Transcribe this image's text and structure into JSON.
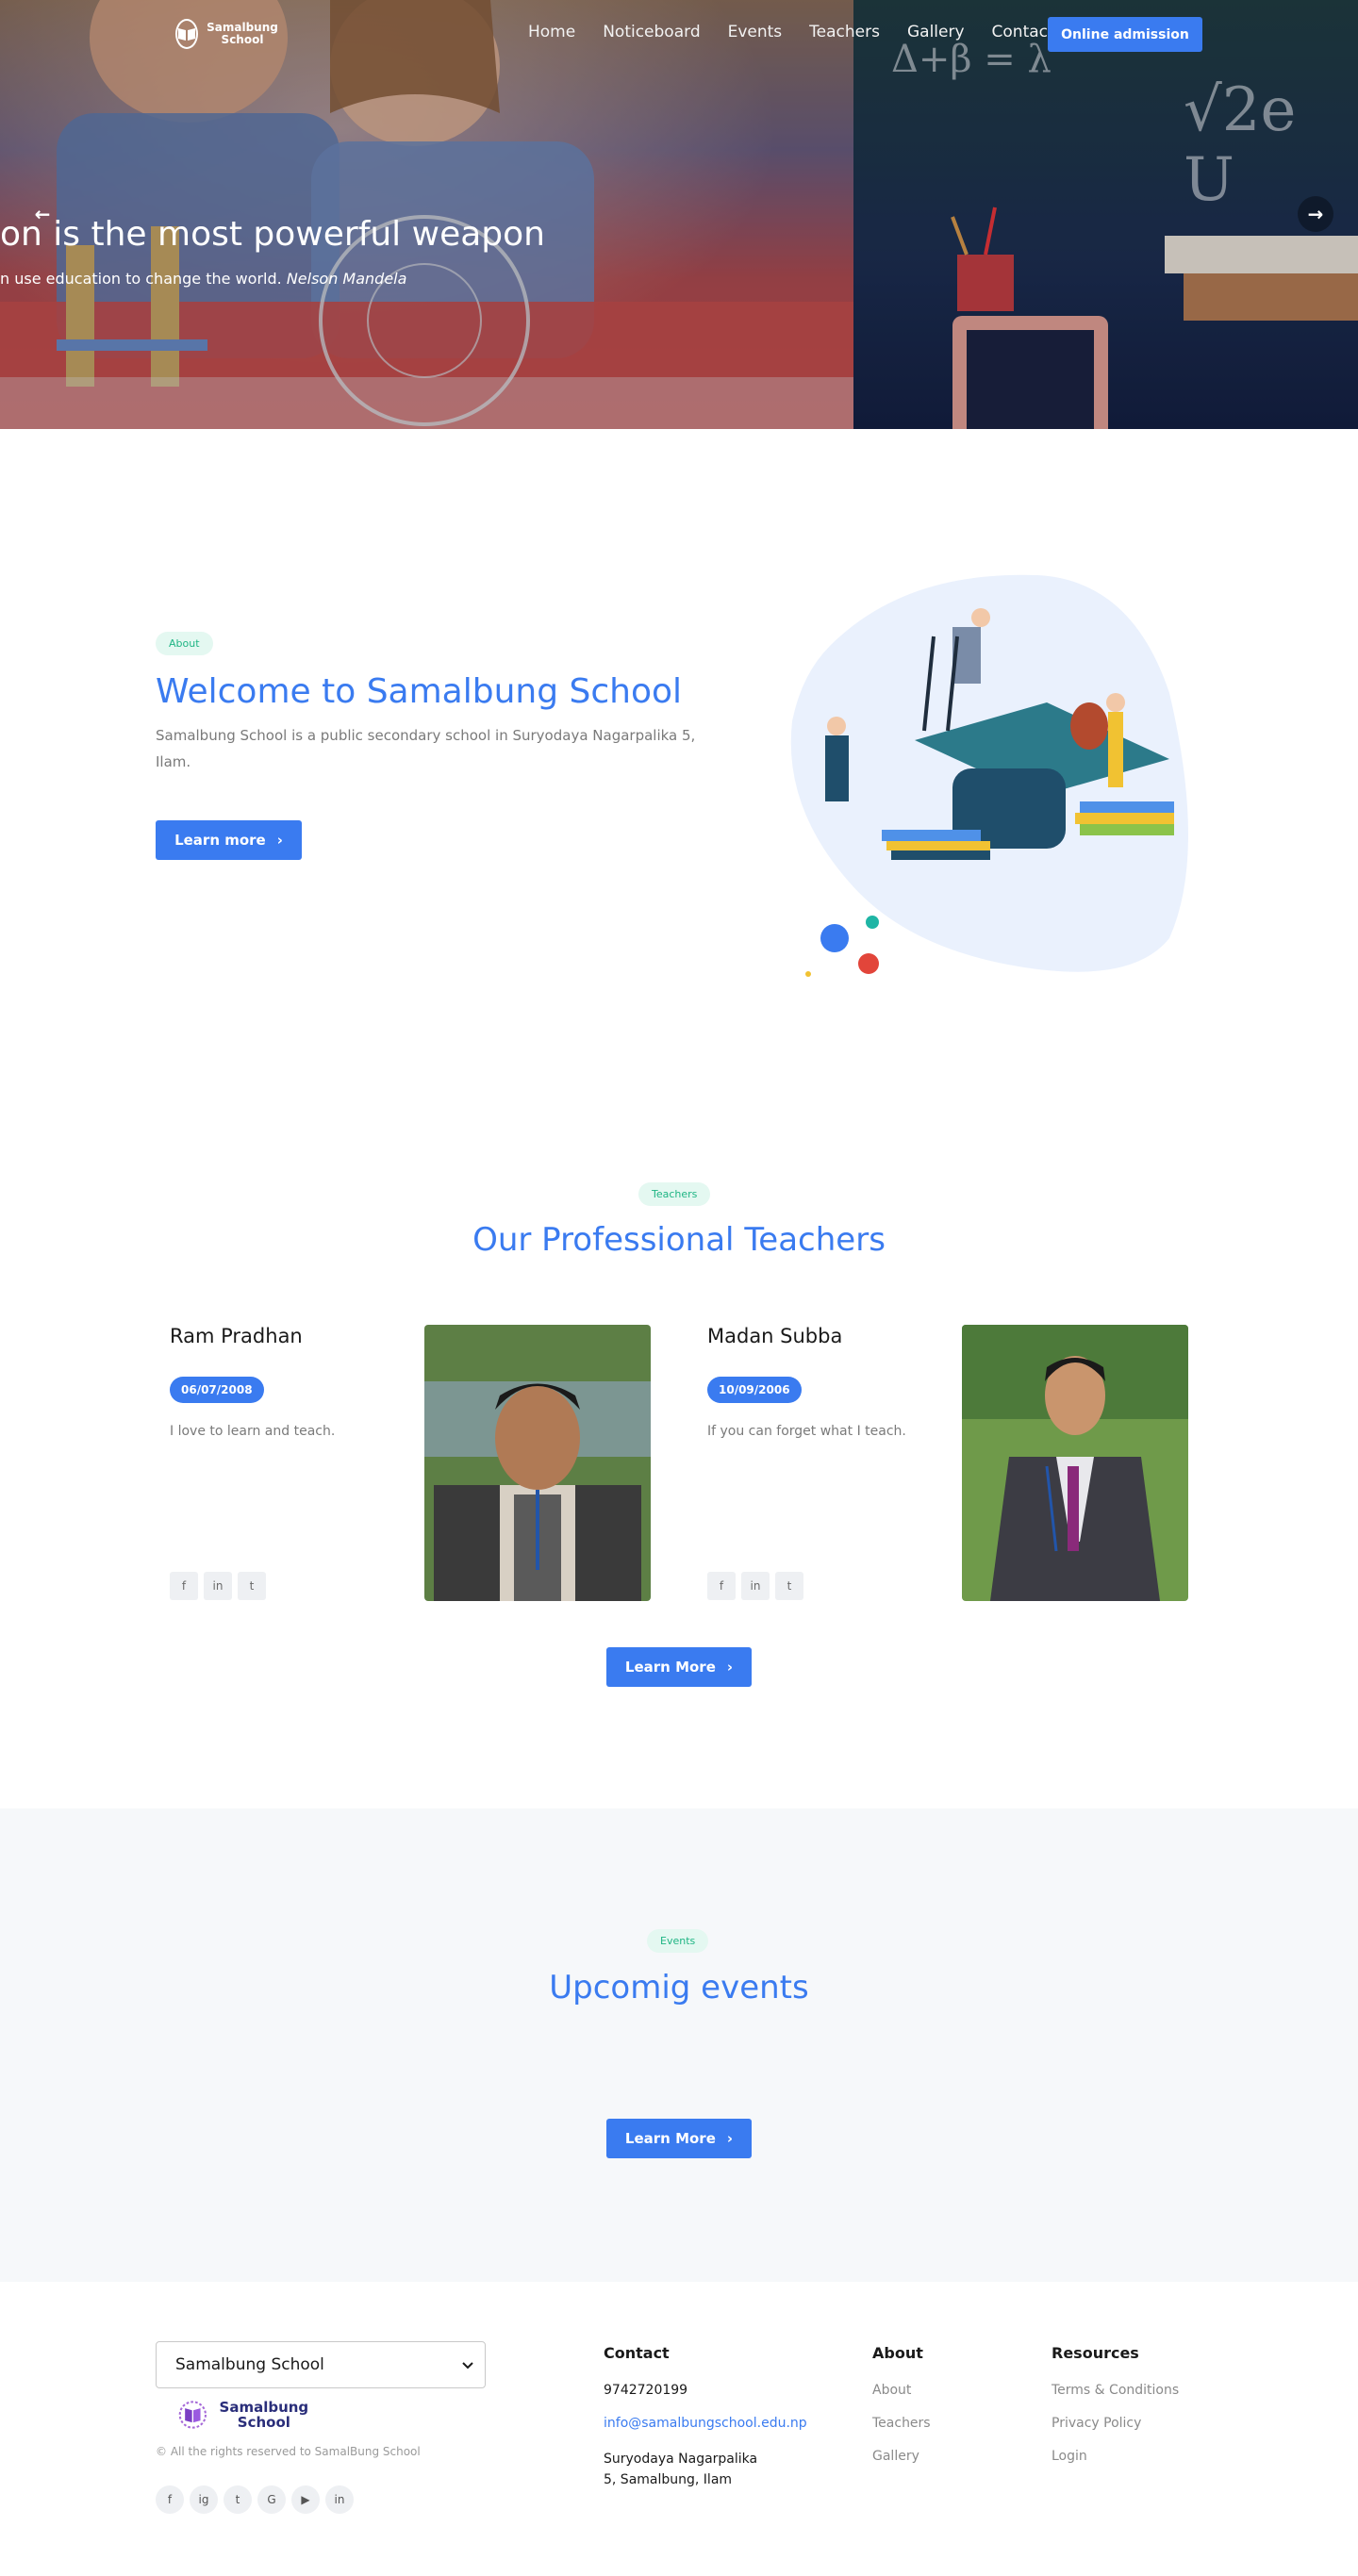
{
  "nav": {
    "logo_text": "Samalbung School",
    "links": [
      "Home",
      "Noticeboard",
      "Events",
      "Teachers",
      "Gallery",
      "Contact"
    ],
    "cta_label": "Online admission"
  },
  "hero": {
    "title": "on is the most powerful weapon",
    "quote_prefix": "n use education to change the world.",
    "quote_author": "Nelson Mandela",
    "prev_icon": "←",
    "next_icon": "→"
  },
  "about": {
    "tag": "About",
    "title": "Welcome to Samalbung School",
    "text": "Samalbung School  is a public secondary school in Suryodaya Nagarpalika 5, Ilam.",
    "button_label": "Learn more",
    "button_icon": "›"
  },
  "teachers": {
    "tag": "Teachers",
    "title": "Our Professional Teachers",
    "items": [
      {
        "name": "Ram Pradhan",
        "date": "06/07/2008",
        "quote": "I love to learn and teach."
      },
      {
        "name": "Madan Subba",
        "date": "10/09/2006",
        "quote": "If you can forget what I teach."
      }
    ],
    "social_icons": [
      "f",
      "in",
      "t"
    ],
    "button_label": "Learn More",
    "button_icon": "›"
  },
  "events": {
    "tag": "Events",
    "title": "Upcomig events",
    "button_label": "Learn More",
    "button_icon": "›"
  },
  "footer": {
    "select_value": "Samalbung School",
    "logo_text": "Samalbung School",
    "copyright": "© All the rights reserved to SamalBung School",
    "social_icons": [
      "f",
      "ig",
      "t",
      "G",
      "▶",
      "in"
    ],
    "contact": {
      "heading": "Contact",
      "phone": "9742720199",
      "email": "info@samalbungschool.edu.np",
      "address": "Suryodaya Nagarpalika 5, Samalbung, Ilam"
    },
    "about": {
      "heading": "About",
      "links": [
        "About",
        "Teachers",
        "Gallery"
      ]
    },
    "resources": {
      "heading": "Resources",
      "links": [
        "Terms & Conditions",
        "Privacy Policy",
        "Login"
      ]
    }
  },
  "colors": {
    "primary": "#3a7bf0",
    "tag_bg": "#e4f8f1",
    "tag_text": "#1fb584",
    "events_bg": "#f6f8fa"
  }
}
